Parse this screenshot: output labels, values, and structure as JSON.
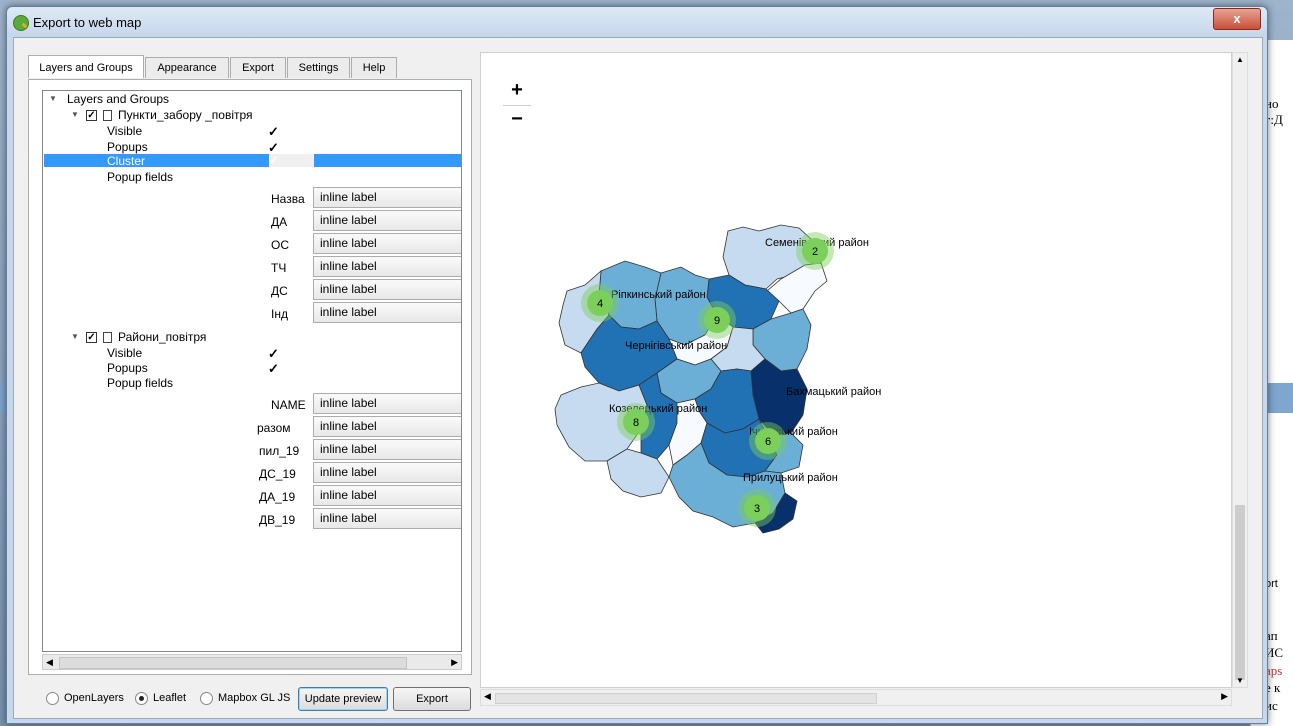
{
  "window": {
    "title": "Export to web map",
    "close_label": "x"
  },
  "tabs": [
    {
      "label": "Layers and Groups",
      "active": true
    },
    {
      "label": "Appearance",
      "active": false
    },
    {
      "label": "Export",
      "active": false
    },
    {
      "label": "Settings",
      "active": false
    },
    {
      "label": "Help",
      "active": false
    }
  ],
  "tree": {
    "root_label": "Layers and Groups",
    "layer1": {
      "name": "Пункти_забору _повітря",
      "checked": true,
      "visible_label": "Visible",
      "popups_label": "Popups",
      "cluster_label": "Cluster",
      "popup_fields_label": "Popup fields",
      "fields": [
        {
          "name": "Назва",
          "value": "inline label"
        },
        {
          "name": "ДА",
          "value": "inline label"
        },
        {
          "name": "ОС",
          "value": "inline label"
        },
        {
          "name": "ТЧ",
          "value": "inline label"
        },
        {
          "name": "ДС",
          "value": "inline label"
        },
        {
          "name": "Інд",
          "value": "inline label"
        }
      ]
    },
    "layer2": {
      "name": "Райони_повітря",
      "checked": true,
      "visible_label": "Visible",
      "popups_label": "Popups",
      "popup_fields_label": "Popup fields",
      "fields": [
        {
          "name": "NAME",
          "value": "inline label"
        },
        {
          "name": "разом",
          "value": "inline label"
        },
        {
          "name": "пил_19",
          "value": "inline label"
        },
        {
          "name": "ДС_19",
          "value": "inline label"
        },
        {
          "name": "ДА_19",
          "value": "inline label"
        },
        {
          "name": "ДВ_19",
          "value": "inline label"
        }
      ]
    }
  },
  "footer": {
    "radios": [
      {
        "label": "OpenLayers",
        "selected": false
      },
      {
        "label": "Leaflet",
        "selected": true
      },
      {
        "label": "Mapbox GL JS",
        "selected": false
      }
    ],
    "update_preview_label": "Update preview",
    "export_label": "Export"
  },
  "map": {
    "zoom_in_label": "+",
    "zoom_out_label": "−",
    "district_labels": [
      "Семенівський район",
      "Ріпкинський район",
      "Чернігівський район",
      "Бахмацький район",
      "Козелецький район",
      "Ічнянський район",
      "Прилуцький район"
    ],
    "clusters": [
      "2",
      "4",
      "9",
      "8",
      "6",
      "3"
    ],
    "colors": {
      "darkest": "#08306b",
      "dark": "#2171b5",
      "mid": "#6baed6",
      "light": "#c6dbef",
      "lightest": "#f7fbff",
      "cluster": "#7ccf5b"
    }
  },
  "background_text": [
    "но",
    "г:Д",
    "ort",
    "ап",
    "ИС",
    "aps",
    "е к",
    "ис"
  ]
}
